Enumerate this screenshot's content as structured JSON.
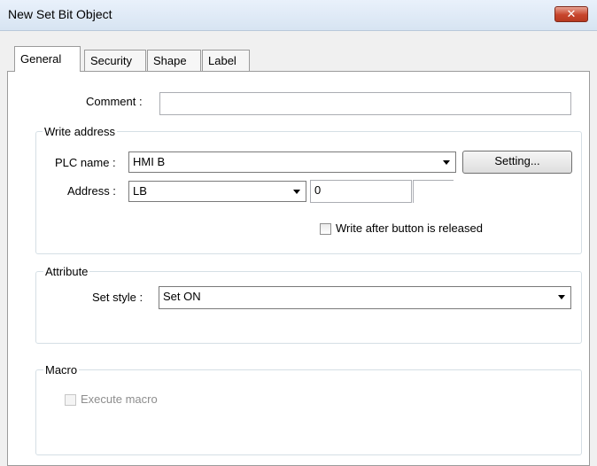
{
  "window": {
    "title": "New  Set Bit Object",
    "close_icon": "close-icon"
  },
  "tabs": [
    {
      "label": "General",
      "active": true
    },
    {
      "label": "Security",
      "active": false
    },
    {
      "label": "Shape",
      "active": false
    },
    {
      "label": "Label",
      "active": false
    }
  ],
  "general": {
    "comment_label": "Comment :",
    "comment_value": ""
  },
  "write_address": {
    "title": "Write address",
    "plc_name_label": "PLC name :",
    "plc_name_value": "HMI B",
    "setting_button": "Setting...",
    "address_label": "Address :",
    "address_device": "LB",
    "address_value": "0",
    "write_after_release_label": "Write after button is released",
    "write_after_release_checked": false
  },
  "attribute": {
    "title": "Attribute",
    "set_style_label": "Set style :",
    "set_style_value": "Set ON"
  },
  "macro": {
    "title": "Macro",
    "execute_macro_label": "Execute macro",
    "execute_macro_checked": false,
    "execute_macro_enabled": false
  }
}
